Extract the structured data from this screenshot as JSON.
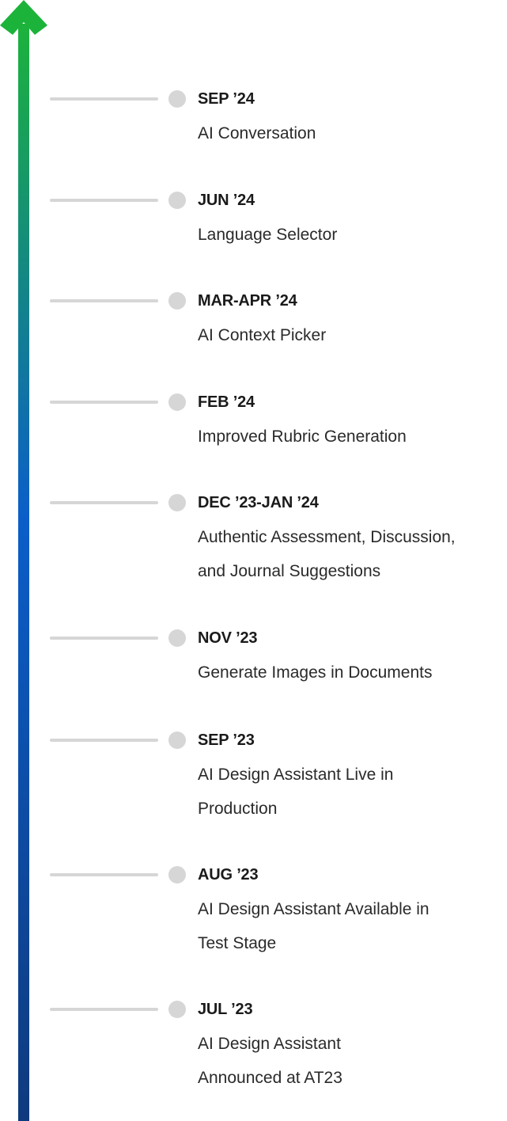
{
  "timeline": {
    "gradient": {
      "top": "#1cb33b",
      "middle": "#0b5ec9",
      "bottom": "#0f3a7e"
    },
    "connector_color": "#d6d6d6",
    "events": [
      {
        "date": "SEP ’24",
        "title_lines": [
          "AI Conversation"
        ]
      },
      {
        "date": "JUN ’24",
        "title_lines": [
          "Language Selector"
        ]
      },
      {
        "date": "MAR-APR ’24",
        "title_lines": [
          "AI Context Picker"
        ]
      },
      {
        "date": "FEB ’24",
        "title_lines": [
          "Improved Rubric Generation"
        ]
      },
      {
        "date": "DEC ’23-JAN ’24",
        "title_lines": [
          "Authentic Assessment, Discussion,",
          "and Journal Suggestions"
        ]
      },
      {
        "date": "NOV ’23",
        "title_lines": [
          "Generate Images in Documents"
        ]
      },
      {
        "date": "SEP ’23",
        "title_lines": [
          "AI Design Assistant Live in",
          "Production"
        ]
      },
      {
        "date": "AUG ’23",
        "title_lines": [
          "AI Design Assistant Available in",
          "Test Stage"
        ]
      },
      {
        "date": "JUL ’23",
        "title_lines": [
          "AI Design Assistant",
          "Announced at AT23"
        ]
      }
    ]
  }
}
